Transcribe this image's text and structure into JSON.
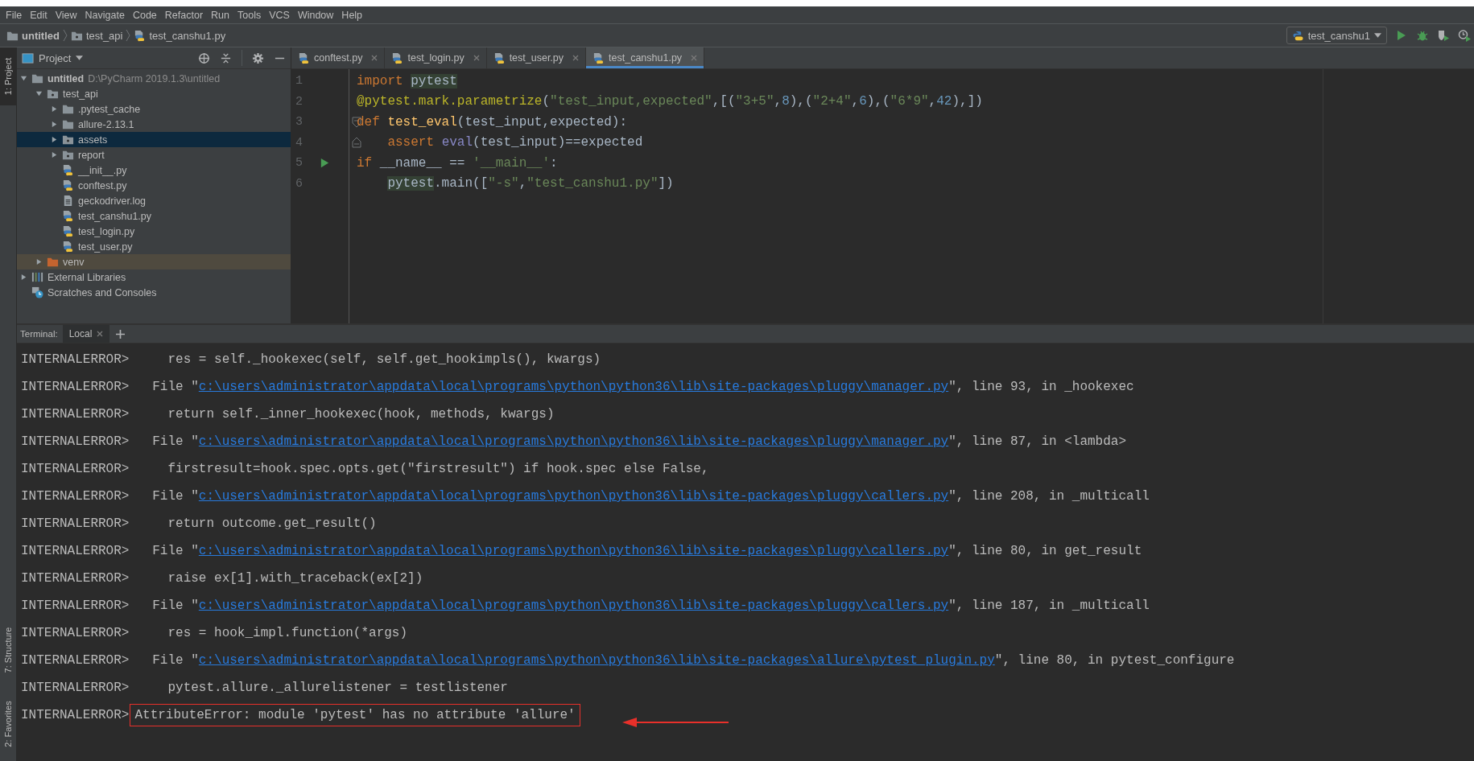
{
  "menu": [
    "File",
    "Edit",
    "View",
    "Navigate",
    "Code",
    "Refactor",
    "Run",
    "Tools",
    "VCS",
    "Window",
    "Help"
  ],
  "breadcrumbs": [
    {
      "label": "untitled",
      "kind": "folder"
    },
    {
      "label": "test_api",
      "kind": "module-folder"
    },
    {
      "label": "test_canshu1.py",
      "kind": "python"
    }
  ],
  "run_config": {
    "label": "test_canshu1"
  },
  "left_stripe": {
    "top": [
      {
        "label": "1: Project",
        "selected": true
      }
    ],
    "bottom": [
      {
        "label": "7: Structure",
        "selected": false
      },
      {
        "label": "2: Favorites",
        "selected": false
      }
    ]
  },
  "project_panel": {
    "title": "Project",
    "tree": [
      {
        "label": "untitled",
        "hint": "D:\\PyCharm 2019.1.3\\untitled",
        "kind": "folder",
        "expanded": true,
        "selected": false,
        "children": [
          {
            "label": "test_api",
            "kind": "module-folder",
            "expanded": true,
            "selected": false,
            "children": [
              {
                "label": ".pytest_cache",
                "kind": "folder",
                "expanded": false,
                "selected": false
              },
              {
                "label": "allure-2.13.1",
                "kind": "folder",
                "expanded": false,
                "selected": false
              },
              {
                "label": "assets",
                "kind": "module-folder",
                "expanded": false,
                "selected": true
              },
              {
                "label": "report",
                "kind": "module-folder",
                "expanded": false,
                "selected": false
              },
              {
                "label": "__init__.py",
                "kind": "python",
                "selected": false
              },
              {
                "label": "conftest.py",
                "kind": "python",
                "selected": false
              },
              {
                "label": "geckodriver.log",
                "kind": "text",
                "selected": false
              },
              {
                "label": "test_canshu1.py",
                "kind": "python",
                "selected": false
              },
              {
                "label": "test_login.py",
                "kind": "python",
                "selected": false
              },
              {
                "label": "test_user.py",
                "kind": "python",
                "selected": false
              }
            ]
          },
          {
            "label": "venv",
            "kind": "excluded-folder",
            "expanded": false,
            "selected": false
          }
        ]
      },
      {
        "label": "External Libraries",
        "kind": "libraries",
        "expanded": false,
        "selected": false
      },
      {
        "label": "Scratches and Consoles",
        "kind": "scratches",
        "selected": false
      }
    ]
  },
  "editor": {
    "tabs": [
      {
        "label": "conftest.py",
        "selected": false
      },
      {
        "label": "test_login.py",
        "selected": false
      },
      {
        "label": "test_user.py",
        "selected": false
      },
      {
        "label": "test_canshu1.py",
        "selected": true
      }
    ],
    "lines": [
      {
        "number": "1",
        "tokens": [
          {
            "kind": "keyword",
            "text": "import "
          },
          {
            "kind": "highlight",
            "text": "pytest"
          }
        ]
      },
      {
        "number": "2",
        "tokens": [
          {
            "kind": "decorator",
            "text": "@pytest.mark.parametrize"
          },
          {
            "kind": "plain",
            "text": "("
          },
          {
            "kind": "string",
            "text": "\"test_input,expected\""
          },
          {
            "kind": "plain",
            "text": ",[("
          },
          {
            "kind": "string",
            "text": "\"3+5\""
          },
          {
            "kind": "plain",
            "text": ","
          },
          {
            "kind": "number",
            "text": "8"
          },
          {
            "kind": "plain",
            "text": "),("
          },
          {
            "kind": "string",
            "text": "\"2+4\""
          },
          {
            "kind": "plain",
            "text": ","
          },
          {
            "kind": "number",
            "text": "6"
          },
          {
            "kind": "plain",
            "text": "),("
          },
          {
            "kind": "string",
            "text": "\"6*9\""
          },
          {
            "kind": "plain",
            "text": ","
          },
          {
            "kind": "number",
            "text": "42"
          },
          {
            "kind": "plain",
            "text": "),])"
          }
        ]
      },
      {
        "number": "3",
        "gutter": {
          "kind": "fold-start"
        },
        "tokens": [
          {
            "kind": "keyword",
            "text": "def "
          },
          {
            "kind": "funcname",
            "text": "test_eval"
          },
          {
            "kind": "plain",
            "text": "(test_input,expected):"
          }
        ]
      },
      {
        "number": "4",
        "indented": true,
        "gutter": {
          "kind": "fold-end"
        },
        "tokens": [
          {
            "kind": "keyword",
            "text": "assert "
          },
          {
            "kind": "builtin",
            "text": "eval"
          },
          {
            "kind": "plain",
            "text": "(test_input)==expected"
          }
        ]
      },
      {
        "number": "5",
        "gutter": {
          "kind": "run"
        },
        "tokens": [
          {
            "kind": "keyword",
            "text": "if "
          },
          {
            "kind": "plain",
            "text": "__name__ == "
          },
          {
            "kind": "string",
            "text": "'__main__'"
          },
          {
            "kind": "plain",
            "text": ":"
          }
        ]
      },
      {
        "number": "6",
        "indented": true,
        "tokens": [
          {
            "kind": "highlight",
            "text": "pytest"
          },
          {
            "kind": "plain",
            "text": ".main(["
          },
          {
            "kind": "string",
            "text": "\"-s\""
          },
          {
            "kind": "plain",
            "text": ","
          },
          {
            "kind": "string",
            "text": "\"test_canshu1.py\""
          },
          {
            "kind": "plain",
            "text": "])"
          }
        ]
      }
    ]
  },
  "terminal": {
    "label": "Terminal:",
    "tabs": [
      {
        "label": "Local",
        "selected": true
      }
    ],
    "lines": [
      {
        "prompt": "INTERNALERROR>",
        "kind": "code",
        "text": "res = self._hookexec(self, self.get_hookimpls(), kwargs)"
      },
      {
        "prompt": "INTERNALERROR>",
        "kind": "file",
        "before": "File \"",
        "link": "c:\\users\\administrator\\appdata\\local\\programs\\python\\python36\\lib\\site-packages\\pluggy\\manager.py",
        "after": "\", line 93, in _hookexec"
      },
      {
        "prompt": "INTERNALERROR>",
        "kind": "code",
        "text": "return self._inner_hookexec(hook, methods, kwargs)"
      },
      {
        "prompt": "INTERNALERROR>",
        "kind": "file",
        "before": "File \"",
        "link": "c:\\users\\administrator\\appdata\\local\\programs\\python\\python36\\lib\\site-packages\\pluggy\\manager.py",
        "after": "\", line 87, in <lambda>"
      },
      {
        "prompt": "INTERNALERROR>",
        "kind": "code",
        "text": "firstresult=hook.spec.opts.get(\"firstresult\") if hook.spec else False,"
      },
      {
        "prompt": "INTERNALERROR>",
        "kind": "file",
        "before": "File \"",
        "link": "c:\\users\\administrator\\appdata\\local\\programs\\python\\python36\\lib\\site-packages\\pluggy\\callers.py",
        "after": "\", line 208, in _multicall"
      },
      {
        "prompt": "INTERNALERROR>",
        "kind": "code",
        "text": "return outcome.get_result()"
      },
      {
        "prompt": "INTERNALERROR>",
        "kind": "file",
        "before": "File \"",
        "link": "c:\\users\\administrator\\appdata\\local\\programs\\python\\python36\\lib\\site-packages\\pluggy\\callers.py",
        "after": "\", line 80, in get_result"
      },
      {
        "prompt": "INTERNALERROR>",
        "kind": "code",
        "text": "raise ex[1].with_traceback(ex[2])"
      },
      {
        "prompt": "INTERNALERROR>",
        "kind": "file",
        "before": "File \"",
        "link": "c:\\users\\administrator\\appdata\\local\\programs\\python\\python36\\lib\\site-packages\\pluggy\\callers.py",
        "after": "\", line 187, in _multicall"
      },
      {
        "prompt": "INTERNALERROR>",
        "kind": "code",
        "text": "res = hook_impl.function(*args)"
      },
      {
        "prompt": "INTERNALERROR>",
        "kind": "file",
        "before": "File \"",
        "link": "c:\\users\\administrator\\appdata\\local\\programs\\python\\python36\\lib\\site-packages\\allure\\pytest_plugin.py",
        "after": "\", line 80, in pytest_configure"
      },
      {
        "prompt": "INTERNALERROR>",
        "kind": "code",
        "text": "pytest.allure._allurelistener = testlistener"
      },
      {
        "prompt": "INTERNALERROR>",
        "kind": "error",
        "text": "AttributeError: module 'pytest' has no attribute 'allure'"
      }
    ]
  }
}
